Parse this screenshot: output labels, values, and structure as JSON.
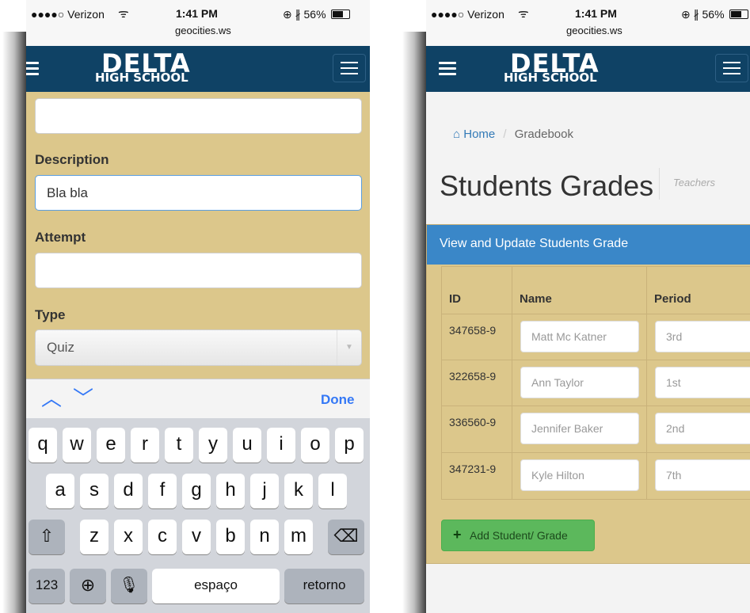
{
  "phone1": {
    "status": {
      "carrier": "●●●●○ Verizon",
      "time": "1:41 PM",
      "url": "geocities.ws",
      "battery": "56%",
      "battery_level": 0.56
    },
    "logo": {
      "main": "DELTA",
      "sub": "HIGH SCHOOL"
    },
    "form": {
      "description_label": "Description",
      "description_value": "Bla bla",
      "attempt_label": "Attempt",
      "attempt_value": "",
      "type_label": "Type",
      "type_value": "Quiz"
    },
    "keyboard": {
      "done_label": "Done",
      "row1": [
        "q",
        "w",
        "e",
        "r",
        "t",
        "y",
        "u",
        "i",
        "o",
        "p"
      ],
      "row2": [
        "a",
        "s",
        "d",
        "f",
        "g",
        "h",
        "j",
        "k",
        "l"
      ],
      "row3": [
        "z",
        "x",
        "c",
        "v",
        "b",
        "n",
        "m"
      ],
      "numbers_label": "123",
      "space_label": "espaço",
      "return_label": "retorno"
    }
  },
  "phone2": {
    "status": {
      "carrier": "●●●●○ Verizon",
      "time": "1:41 PM",
      "url": "geocities.ws",
      "battery": "56%",
      "battery_level": 0.56
    },
    "logo": {
      "main": "DELTA",
      "sub": "HIGH SCHOOL"
    },
    "breadcrumb": {
      "home": "Home",
      "separator": "/",
      "current": "Gradebook"
    },
    "title": "Students Grades",
    "subtitle": "Teachers",
    "panel_heading": "View and Update Students Grade",
    "table": {
      "headers": {
        "id": "ID",
        "name": "Name",
        "period": "Period"
      },
      "rows": [
        {
          "id": "347658-9",
          "name": "Matt Mc Katner",
          "period": "3rd"
        },
        {
          "id": "322658-9",
          "name": "Ann Taylor",
          "period": "1st"
        },
        {
          "id": "336560-9",
          "name": "Jennifer Baker",
          "period": "2nd"
        },
        {
          "id": "347231-9",
          "name": "Kyle Hilton",
          "period": "7th"
        }
      ]
    },
    "add_button": "Add Student/ Grade"
  },
  "colors": {
    "navbar": "#0f4265",
    "tan": "#dcc78b",
    "panel_heading": "#3a87c8",
    "add_button": "#5cb85c",
    "link": "#337ab7"
  }
}
